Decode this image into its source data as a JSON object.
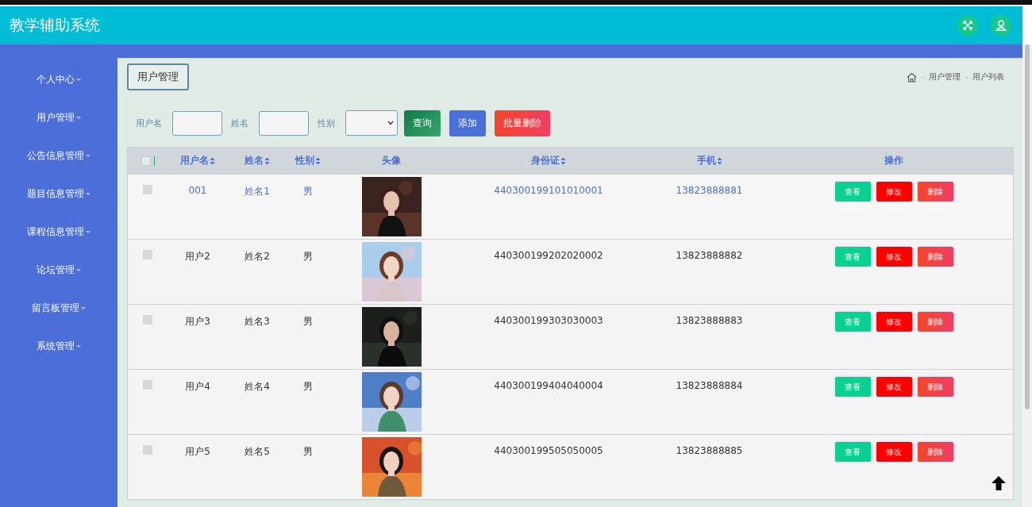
{
  "app": {
    "title": "教学辅助系统"
  },
  "sidebar": {
    "items": [
      {
        "label": "个人中心"
      },
      {
        "label": "用户管理"
      },
      {
        "label": "公告信息管理"
      },
      {
        "label": "题目信息管理"
      },
      {
        "label": "课程信息管理"
      },
      {
        "label": "论坛管理"
      },
      {
        "label": "留言板管理"
      },
      {
        "label": "系统管理"
      }
    ]
  },
  "page_tab": "用户管理",
  "breadcrumb": [
    "用户管理",
    "用户列表"
  ],
  "filters": [
    {
      "label": "用户名",
      "kind": "text"
    },
    {
      "label": "姓名",
      "kind": "text"
    },
    {
      "label": "性别",
      "kind": "select"
    }
  ],
  "buttons": [
    {
      "label": "查询",
      "kind": "search"
    },
    {
      "label": "添加",
      "kind": "add"
    },
    {
      "label": "批量删除",
      "kind": "delete"
    }
  ],
  "table": {
    "select_all": {
      "checked": false
    },
    "columns": [
      {
        "label": "用户名",
        "sortable": true
      },
      {
        "label": "姓名",
        "sortable": true
      },
      {
        "label": "性别",
        "sortable": true
      },
      {
        "label": "头像",
        "sortable": false
      },
      {
        "label": "身份证",
        "sortable": true
      },
      {
        "label": "手机",
        "sortable": true
      },
      {
        "label": "操作",
        "sortable": false
      }
    ],
    "rows": [
      {
        "selected": true,
        "checked": false,
        "username": "001",
        "name": "姓名1",
        "gender": "男",
        "id_card": "440300199101010001",
        "phone": "13823888881",
        "actions": [
          {
            "label": "查看",
            "kind": "view"
          },
          {
            "label": "修改",
            "kind": "edit"
          },
          {
            "label": "删除",
            "kind": "delete"
          }
        ]
      },
      {
        "selected": false,
        "checked": false,
        "username": "用户2",
        "name": "姓名2",
        "gender": "男",
        "id_card": "440300199202020002",
        "phone": "13823888882",
        "actions": [
          {
            "label": "查看",
            "kind": "view"
          },
          {
            "label": "修改",
            "kind": "edit"
          },
          {
            "label": "删除",
            "kind": "delete"
          }
        ]
      },
      {
        "selected": false,
        "checked": false,
        "username": "用户3",
        "name": "姓名3",
        "gender": "男",
        "id_card": "440300199303030003",
        "phone": "13823888883",
        "actions": [
          {
            "label": "查看",
            "kind": "view"
          },
          {
            "label": "修改",
            "kind": "edit"
          },
          {
            "label": "删除",
            "kind": "delete"
          }
        ]
      },
      {
        "selected": false,
        "checked": false,
        "username": "用户4",
        "name": "姓名4",
        "gender": "男",
        "id_card": "440300199404040004",
        "phone": "13823888884",
        "actions": [
          {
            "label": "查看",
            "kind": "view"
          },
          {
            "label": "修改",
            "kind": "edit"
          },
          {
            "label": "删除",
            "kind": "delete"
          }
        ]
      },
      {
        "selected": false,
        "checked": false,
        "username": "用户5",
        "name": "姓名5",
        "gender": "男",
        "id_card": "440300199505050005",
        "phone": "13823888885",
        "actions": [
          {
            "label": "查看",
            "kind": "view"
          },
          {
            "label": "修改",
            "kind": "edit"
          },
          {
            "label": "删除",
            "kind": "delete"
          }
        ]
      }
    ]
  }
}
